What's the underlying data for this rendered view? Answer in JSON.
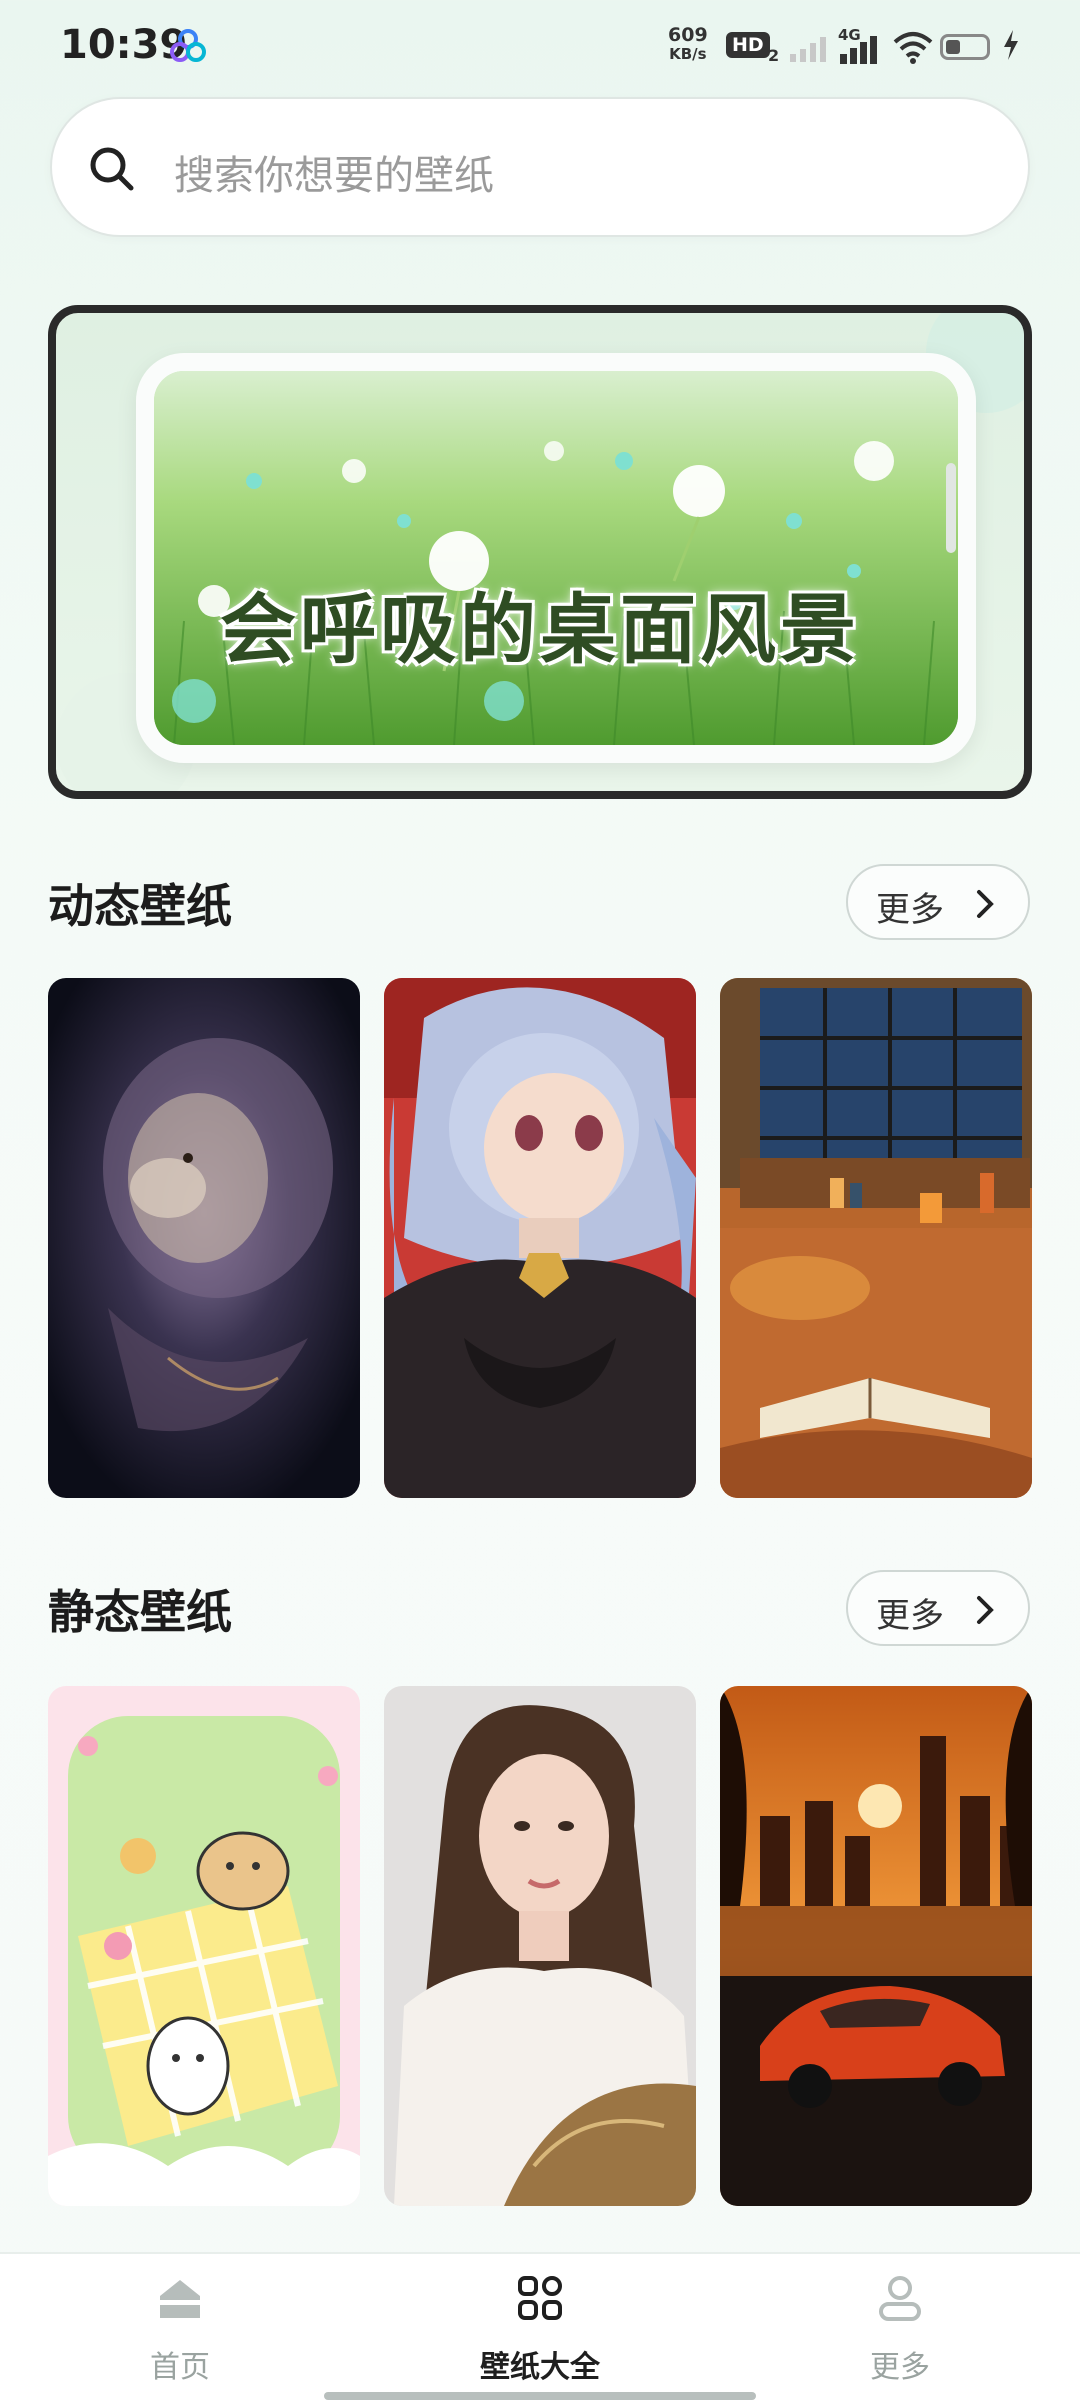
{
  "status_bar": {
    "time": "10:39",
    "net_speed_value": "609",
    "net_speed_unit": "KB/s",
    "hd_label": "HD",
    "hd_sub": "2",
    "network_type": "4G"
  },
  "search": {
    "placeholder": "搜索你想要的壁纸"
  },
  "banner": {
    "title": "会呼吸的桌面风景"
  },
  "sections": {
    "dynamic": {
      "title": "动态壁纸",
      "more_label": "更多",
      "cards": [
        {
          "subject": "cosmic lion"
        },
        {
          "subject": "anime girl"
        },
        {
          "subject": "cozy reading room with cat"
        }
      ]
    },
    "static": {
      "title": "静态壁纸",
      "more_label": "更多",
      "cards": [
        {
          "subject": "cute picnic illustration"
        },
        {
          "subject": "portrait of a woman"
        },
        {
          "subject": "city sunset with sports car"
        }
      ]
    }
  },
  "bottom_nav": {
    "items": [
      {
        "label": "首页",
        "icon": "home-icon",
        "active": false
      },
      {
        "label": "壁纸大全",
        "icon": "grid-icon",
        "active": true
      },
      {
        "label": "更多",
        "icon": "person-icon",
        "active": false
      }
    ]
  },
  "colors": {
    "accent_dark": "#1f1f1f",
    "nav_inactive": "#9aa3a0",
    "background": "#f3faf6"
  }
}
